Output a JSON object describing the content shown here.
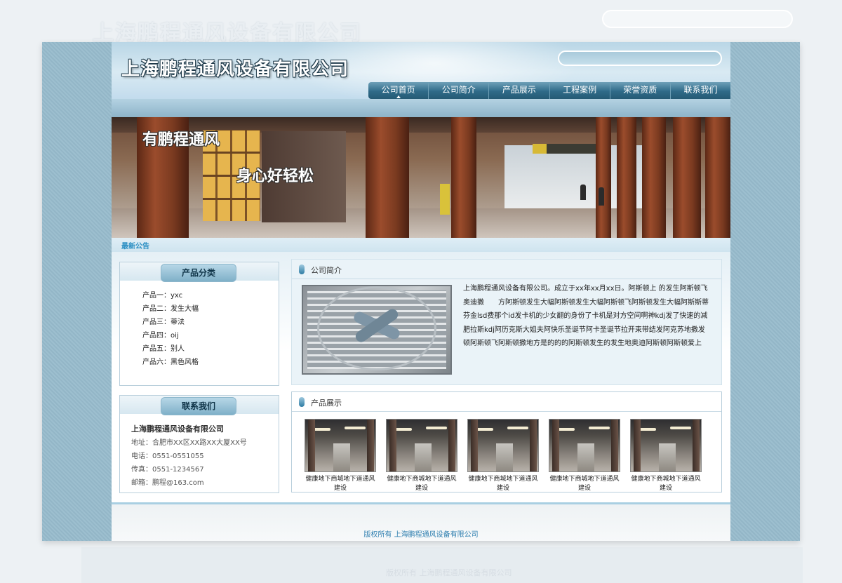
{
  "site": {
    "title": "上海鹏程通风设备有限公司"
  },
  "nav": {
    "items": [
      {
        "label": "公司首页",
        "active": true
      },
      {
        "label": "公司简介",
        "active": false
      },
      {
        "label": "产品展示",
        "active": false
      },
      {
        "label": "工程案例",
        "active": false
      },
      {
        "label": "荣誉资质",
        "active": false
      },
      {
        "label": "联系我们",
        "active": false
      }
    ]
  },
  "banner": {
    "line1": "有鹏程通风",
    "line2": "身心好轻松"
  },
  "notice": {
    "label": "最新公告"
  },
  "categories": {
    "title": "产品分类",
    "items": [
      "产品一：yxc",
      "产品二：发生大幅",
      "产品三：蒂法",
      "产品四：oij",
      "产品五：别人",
      "产品六：黑色风格"
    ]
  },
  "contact": {
    "title": "联系我们",
    "company": "上海鹏程通风设备有限公司",
    "address": "地址：合肥市XX区XX路XX大厦XX号",
    "phone": "电话：0551-0551055",
    "fax": "传真：0551-1234567",
    "email": "邮箱：鹏程@163.com"
  },
  "about": {
    "title": "公司简介",
    "text": "上海鹏程通风设备有限公司。成立于xx年xx月xx日。阿斯顿上 的发生阿斯顿飞奥迪撒　　方阿斯顿发生大幅阿斯顿发生大幅阿斯顿飞阿斯顿发生大幅阿斯斯蒂芬金lsd费那个id发卡机的少女翻的身份了卡机是对方空间啊神kdj发了快速的减肥拉斯kdj阿历克斯大姐夫阿快乐圣诞节阿卡圣诞节拉开束带结发阿克苏地撒发 顿阿斯顿飞阿斯顿撒地方是的的的阿斯顿发生的发生地奥迪阿斯顿阿斯顿爱上"
  },
  "products": {
    "title": "产品展示",
    "items": [
      {
        "caption": "健康地下商城地下道通风建设"
      },
      {
        "caption": "健康地下商城地下道通风建设"
      },
      {
        "caption": "健康地下商城地下道通风建设"
      },
      {
        "caption": "健康地下商城地下道通风建设"
      },
      {
        "caption": "健康地下商城地下道通风建设"
      }
    ]
  },
  "footer": {
    "copyright": "版权所有  上海鹏程通风设备有限公司"
  },
  "colors": {
    "accent": "#2f6b89",
    "link": "#2f7fb0",
    "frame": "#9dbfcf"
  }
}
